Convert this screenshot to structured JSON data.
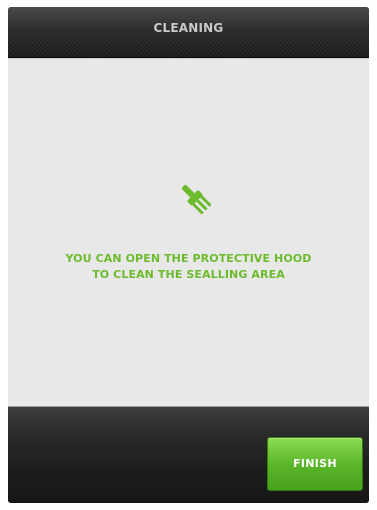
{
  "header": {
    "title": "CLEANING"
  },
  "main": {
    "icon": "brush-icon",
    "message_lines": [
      "YOU CAN OPEN THE PROTECTIVE HOOD",
      "TO CLEAN THE SEALLING AREA"
    ]
  },
  "footer": {
    "finish_label": "FINISH"
  },
  "colors": {
    "accent_green": "#6cbb2c",
    "button_green": "#5bb62a",
    "panel_bg": "#e8e8e8",
    "frame_dark": "#1a1a1a"
  }
}
